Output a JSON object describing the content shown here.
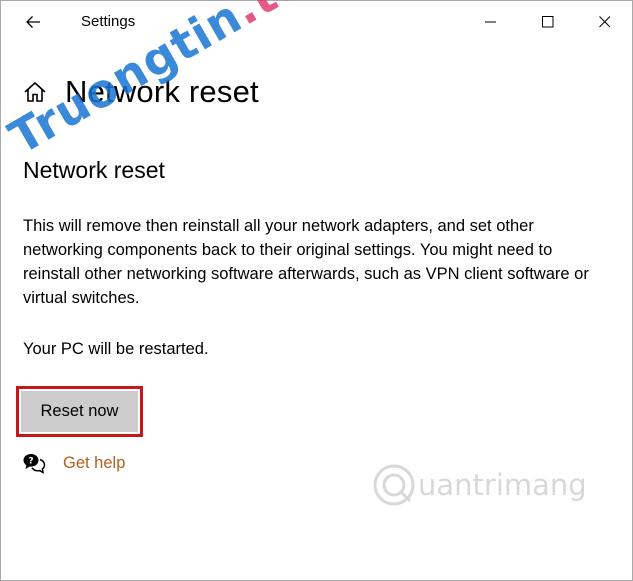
{
  "window": {
    "title": "Settings",
    "back_icon": "back-arrow-icon",
    "controls": [
      "minimize-icon",
      "maximize-icon",
      "close-icon"
    ]
  },
  "page": {
    "title": "Network reset",
    "home_icon": "home-icon"
  },
  "section": {
    "title": "Network reset",
    "description": "This will remove then reinstall all your network adapters, and set other networking components back to their original settings. You might need to reinstall other networking software afterwards, such as VPN client software or virtual switches.",
    "restart_note": "Your PC will be restarted.",
    "reset_button_label": "Reset now"
  },
  "help": {
    "label": "Get help",
    "icon": "help-chat-icon"
  },
  "watermarks": {
    "primary": "Truongtin.top",
    "secondary": "uantrimang"
  },
  "colors": {
    "highlight_border": "#c8161d",
    "button_bg": "#cccccc",
    "link": "#b55f1b"
  }
}
